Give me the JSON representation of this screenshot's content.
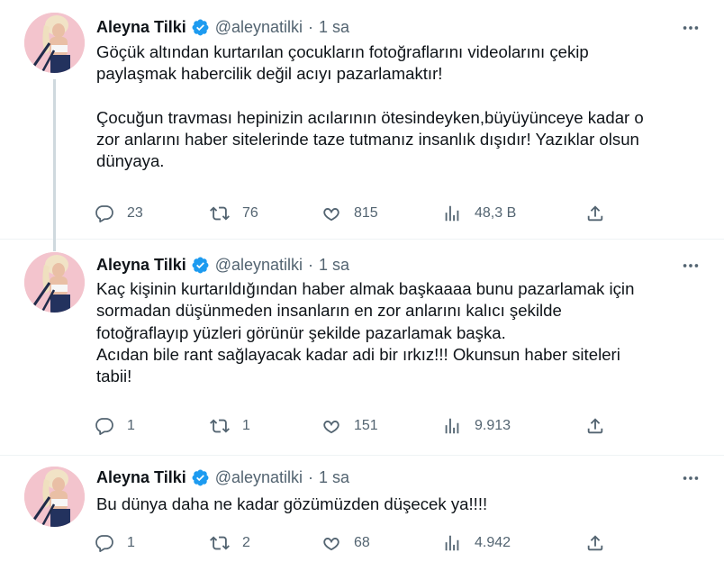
{
  "author": {
    "name": "Aleyna Tilki",
    "handle": "@aleynatilki",
    "separator": "·",
    "verified_color": "#1d9bf0"
  },
  "colors": {
    "text": "#0f1419",
    "secondary": "#536471",
    "divider": "#eff3f4",
    "thread_line": "#cfd9de"
  },
  "icons": {
    "reply": "reply-icon",
    "retweet": "retweet-icon",
    "like": "heart-icon",
    "views": "views-icon",
    "share": "share-icon",
    "more": "more-icon"
  },
  "tweets": [
    {
      "time": "1 sa",
      "text": "Göçük altından kurtarılan çocukların fotoğraflarını videolarını çekip\npaylaşmak habercilik değil acıyı pazarlamaktır!\n\nÇocuğun travması hepinizin acılarının ötesindeyken,büyüyünceye kadar o\nzor anlarını haber sitelerinde taze tutmanız insanlık dışıdır! Yazıklar olsun\ndünyaya.",
      "replies": "23",
      "retweets": "76",
      "likes": "815",
      "views": "48,3 B"
    },
    {
      "time": "1 sa",
      "text": "Kaç kişinin kurtarıldığından haber almak başkaaaa bunu pazarlamak için\nsormadan düşünmeden insanların en zor anlarını kalıcı şekilde\nfotoğraflayıp yüzleri görünür şekilde pazarlamak başka.\nAcıdan bile rant sağlayacak kadar adi bir ırkız!!! Okunsun haber siteleri\ntabii!",
      "replies": "1",
      "retweets": "1",
      "likes": "151",
      "views": "9.913"
    },
    {
      "time": "1 sa",
      "text": "Bu dünya daha ne kadar gözümüzden düşecek ya!!!!",
      "replies": "1",
      "retweets": "2",
      "likes": "68",
      "views": "4.942"
    }
  ]
}
